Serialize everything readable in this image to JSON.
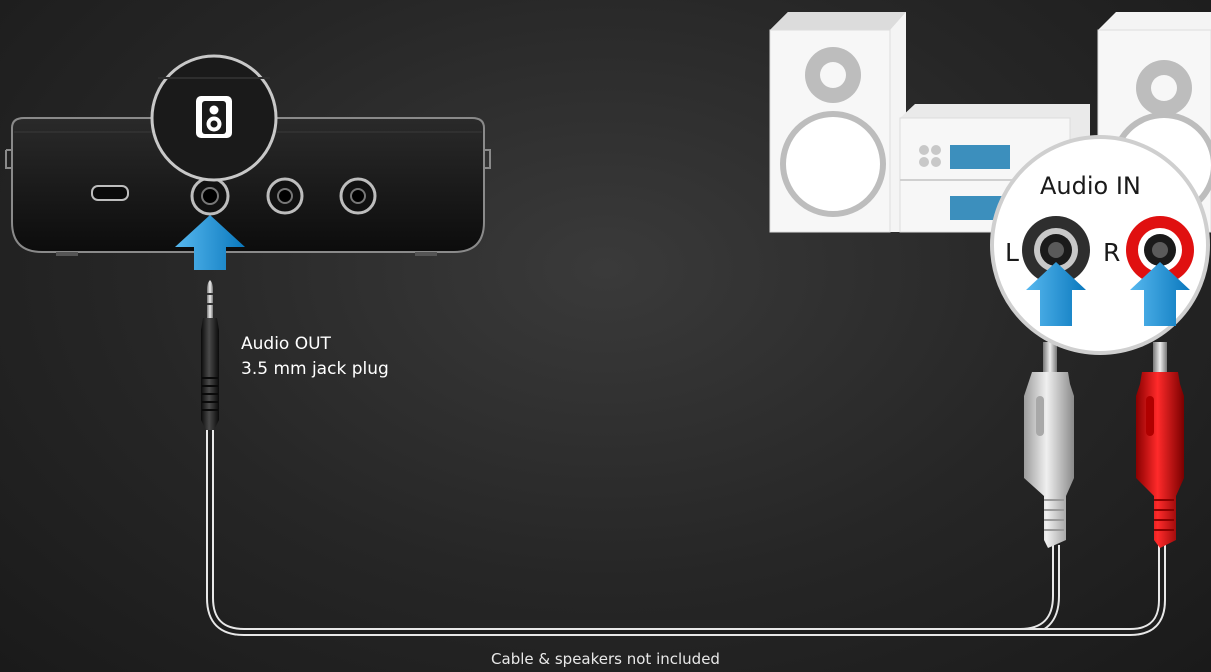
{
  "labels": {
    "audio_out_line1": "Audio OUT",
    "audio_out_line2": "3.5 mm jack plug",
    "audio_in": "Audio IN",
    "left_channel": "L",
    "right_channel": "R",
    "footnote": "Cable & speakers not included"
  },
  "icons": {
    "speaker_port_symbol": "speaker-icon",
    "arrows": "arrow-up-icon"
  },
  "colors": {
    "background": "#262626",
    "arrow_blue": "#1a8fd0",
    "rca_red": "#e01010",
    "rca_white": "#d6d6d6",
    "stereo_white": "#f2f2f2"
  }
}
